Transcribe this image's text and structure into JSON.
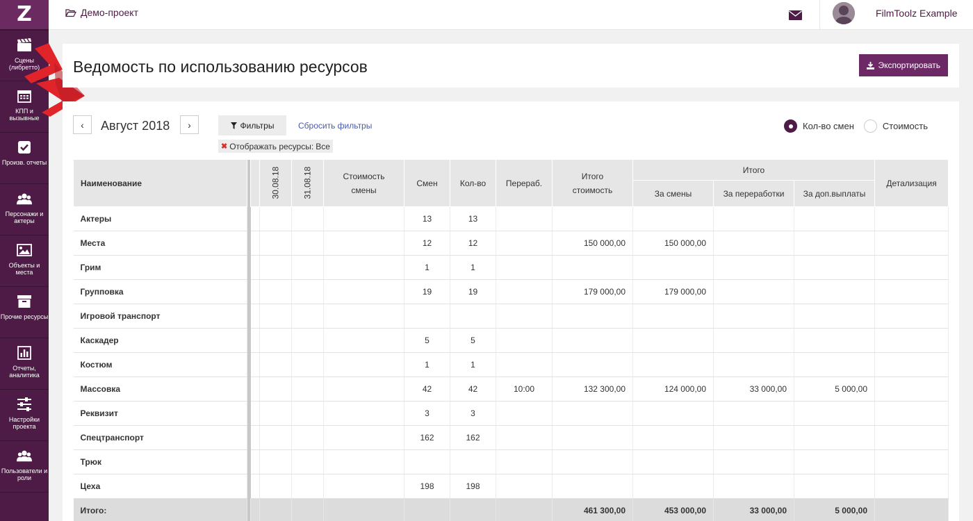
{
  "logo": "Z",
  "nav": [
    {
      "label": "Сцены (либретто)",
      "icon": "clapperboard-icon"
    },
    {
      "label": "КПП и вызывные",
      "icon": "calendar-icon"
    },
    {
      "label": "Произв. отчеты",
      "icon": "checkbox-icon"
    },
    {
      "label": "Персонажи и актеры",
      "icon": "users-icon"
    },
    {
      "label": "Объекты и места",
      "icon": "image-icon"
    },
    {
      "label": "Прочие ресурсы",
      "icon": "archive-icon"
    },
    {
      "label": "Отчеты, аналитика",
      "icon": "bar-chart-icon"
    },
    {
      "label": "Настройки проекта",
      "icon": "sliders-icon"
    },
    {
      "label": "Пользователи и роли",
      "icon": "users-icon"
    }
  ],
  "topbar": {
    "project": "Демо-проект",
    "user_name": "FilmToolz Example"
  },
  "page": {
    "title": "Ведомость по использованию ресурсов",
    "export_label": "Экспортировать"
  },
  "controls": {
    "prev": "‹",
    "next": "›",
    "month": "Август 2018",
    "filters_label": "Фильтры",
    "reset_label": "Сбросить фильтры",
    "chip_label": "Отображать ресурсы:",
    "chip_value": "Все",
    "radio_shifts": "Кол-во смен",
    "radio_cost": "Стоимость",
    "selected": "shifts"
  },
  "table": {
    "headers": {
      "name": "Наименование",
      "date1": "30.08.18",
      "date2": "31.08.18",
      "shift_cost": "Стоимость смены",
      "shifts": "Смен",
      "qty": "Кол-во",
      "overtime": "Перераб.",
      "total_cost": "Итого стоимость",
      "total_group": "Итого",
      "for_shifts": "За смены",
      "for_overtime": "За переработки",
      "for_extra": "За доп.выплаты",
      "details": "Детализация"
    },
    "rows": [
      {
        "name": "Актеры",
        "shifts": "13",
        "qty": "13",
        "overtime": "",
        "total_cost": "",
        "for_shifts": "",
        "for_overtime": "",
        "for_extra": ""
      },
      {
        "name": "Места",
        "shifts": "12",
        "qty": "12",
        "overtime": "",
        "total_cost": "150 000,00",
        "for_shifts": "150 000,00",
        "for_overtime": "",
        "for_extra": ""
      },
      {
        "name": "Грим",
        "shifts": "1",
        "qty": "1",
        "overtime": "",
        "total_cost": "",
        "for_shifts": "",
        "for_overtime": "",
        "for_extra": ""
      },
      {
        "name": "Групповка",
        "shifts": "19",
        "qty": "19",
        "overtime": "",
        "total_cost": "179 000,00",
        "for_shifts": "179 000,00",
        "for_overtime": "",
        "for_extra": ""
      },
      {
        "name": "Игровой транспорт",
        "shifts": "",
        "qty": "",
        "overtime": "",
        "total_cost": "",
        "for_shifts": "",
        "for_overtime": "",
        "for_extra": ""
      },
      {
        "name": "Каскадер",
        "shifts": "5",
        "qty": "5",
        "overtime": "",
        "total_cost": "",
        "for_shifts": "",
        "for_overtime": "",
        "for_extra": ""
      },
      {
        "name": "Костюм",
        "shifts": "1",
        "qty": "1",
        "overtime": "",
        "total_cost": "",
        "for_shifts": "",
        "for_overtime": "",
        "for_extra": ""
      },
      {
        "name": "Массовка",
        "shifts": "42",
        "qty": "42",
        "overtime": "10:00",
        "total_cost": "132 300,00",
        "for_shifts": "124 000,00",
        "for_overtime": "33 000,00",
        "for_extra": "5 000,00"
      },
      {
        "name": "Реквизит",
        "shifts": "3",
        "qty": "3",
        "overtime": "",
        "total_cost": "",
        "for_shifts": "",
        "for_overtime": "",
        "for_extra": ""
      },
      {
        "name": "Спецтранспорт",
        "shifts": "162",
        "qty": "162",
        "overtime": "",
        "total_cost": "",
        "for_shifts": "",
        "for_overtime": "",
        "for_extra": ""
      },
      {
        "name": "Трюк",
        "shifts": "",
        "qty": "",
        "overtime": "",
        "total_cost": "",
        "for_shifts": "",
        "for_overtime": "",
        "for_extra": ""
      },
      {
        "name": "Цеха",
        "shifts": "198",
        "qty": "198",
        "overtime": "",
        "total_cost": "",
        "for_shifts": "",
        "for_overtime": "",
        "for_extra": ""
      }
    ],
    "total": {
      "name": "Итого:",
      "total_cost": "461 300,00",
      "for_shifts": "453 000,00",
      "for_overtime": "33 000,00",
      "for_extra": "5 000,00"
    }
  }
}
